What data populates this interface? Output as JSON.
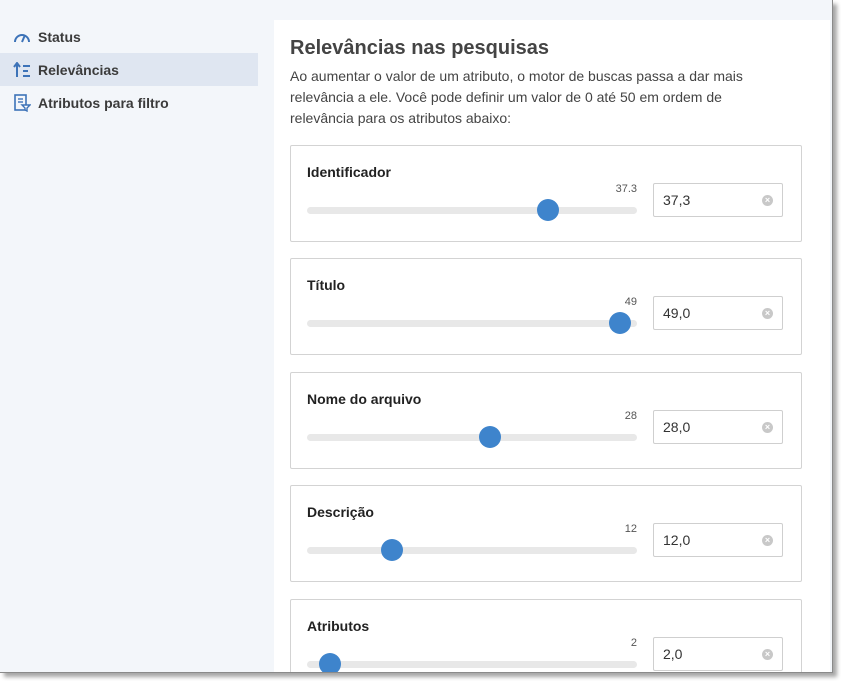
{
  "sidebar": {
    "items": [
      {
        "label": "Status",
        "icon": "gauge-icon",
        "active": false
      },
      {
        "label": "Relevâncias",
        "icon": "sort-relevance-icon",
        "active": true
      },
      {
        "label": "Atributos para filtro",
        "icon": "filter-document-icon",
        "active": false
      }
    ]
  },
  "main": {
    "title": "Relevâncias nas pesquisas",
    "description": "Ao aumentar o valor de um atributo, o motor de buscas passa a dar mais relevância a ele. Você pode definir um valor de 0 até 50 em ordem de relevância para os atributos abaixo:",
    "slider_max": 50,
    "cards": [
      {
        "label": "Identificador",
        "slider_value": "37.3",
        "value": 37.3,
        "input_value": "37,3"
      },
      {
        "label": "Título",
        "slider_value": "49",
        "value": 49,
        "input_value": "49,0"
      },
      {
        "label": "Nome do arquivo",
        "slider_value": "28",
        "value": 28,
        "input_value": "28,0"
      },
      {
        "label": "Descrição",
        "slider_value": "12",
        "value": 12,
        "input_value": "12,0"
      },
      {
        "label": "Atributos",
        "slider_value": "2",
        "value": 2,
        "input_value": "2,0"
      }
    ]
  },
  "colors": {
    "accent": "#3e84cc",
    "sidebar_bg": "#f3f6fa",
    "active_bg": "#dfe6f1"
  }
}
